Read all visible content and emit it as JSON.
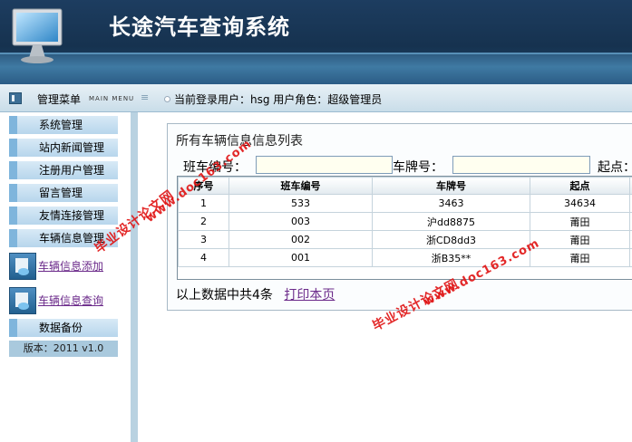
{
  "header": {
    "title": "长途汽车查询系统"
  },
  "menubar": {
    "menu_title": "管理菜单",
    "menu_title_en": "MAIN MENU",
    "login_info": "当前登录用户：hsg  用户角色：超级管理员"
  },
  "sidebar": {
    "items": [
      {
        "label": "系统管理"
      },
      {
        "label": "站内新闻管理"
      },
      {
        "label": "注册用户管理"
      },
      {
        "label": "留言管理"
      },
      {
        "label": "友情连接管理"
      },
      {
        "label": "车辆信息管理"
      }
    ],
    "links": [
      {
        "label": "车辆信息添加",
        "icon": "document-icon"
      },
      {
        "label": "车辆信息查询",
        "icon": "document-icon"
      }
    ],
    "backup": "数据备份",
    "version": "版本：2011 v1.0"
  },
  "main": {
    "title": "所有车辆信息信息列表",
    "search": {
      "label1": "班车编号：",
      "value1": "",
      "label2": "车牌号：",
      "value2": "",
      "label3": "起点："
    },
    "table": {
      "headers": [
        "序号",
        "班车编号",
        "车牌号",
        "起点"
      ],
      "rows": [
        [
          "1",
          "533",
          "3463",
          "34634"
        ],
        [
          "2",
          "003",
          "沪dd8875",
          "莆田"
        ],
        [
          "3",
          "002",
          "浙CD8dd3",
          "莆田"
        ],
        [
          "4",
          "001",
          "浙B35**",
          "莆田"
        ]
      ]
    },
    "footer": {
      "summary": "以上数据中共4条",
      "print": "打印本页"
    }
  },
  "watermarks": [
    "毕业设计论文网",
    "www.doc163.com",
    "毕业设计论文网",
    "www.doc163.com"
  ]
}
